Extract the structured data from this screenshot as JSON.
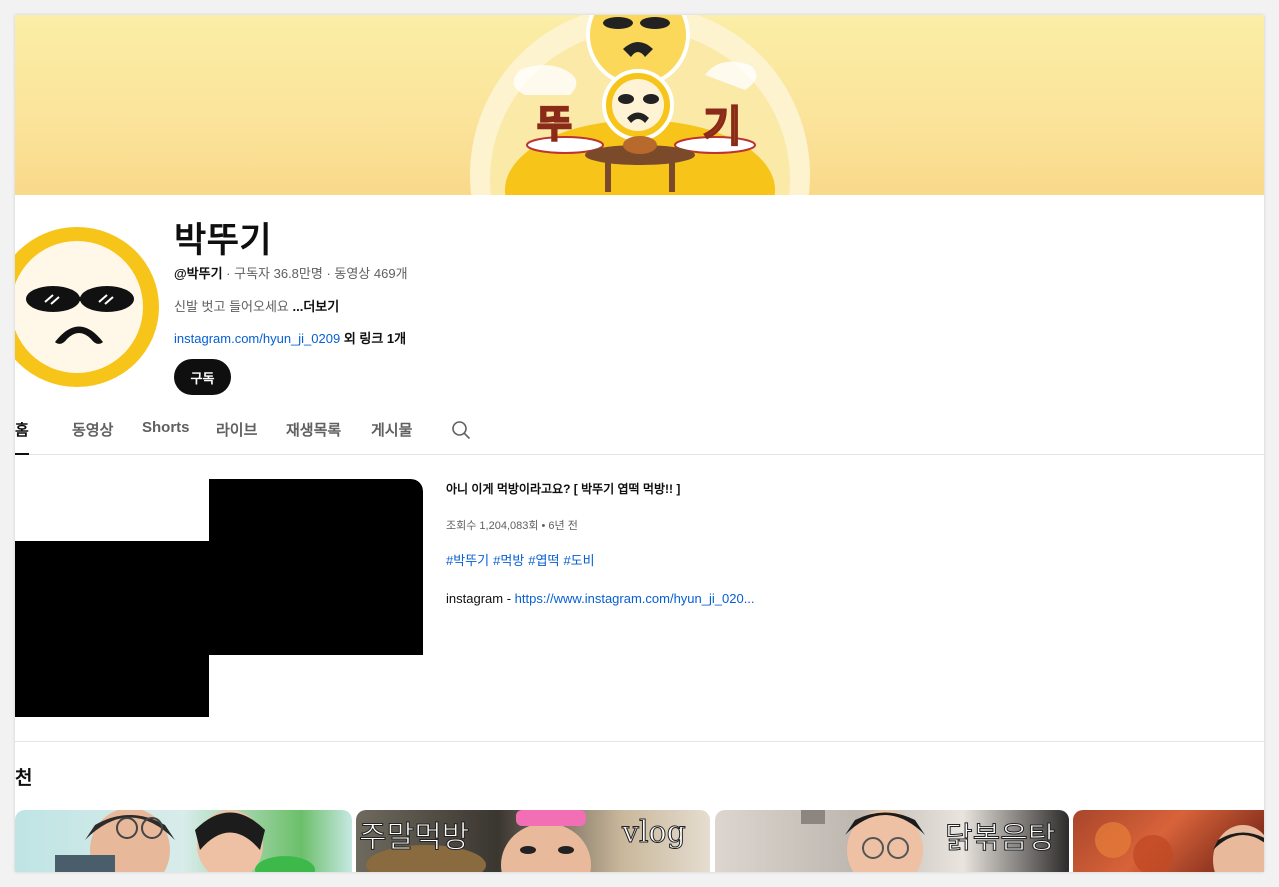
{
  "channel": {
    "name": "박뚜기",
    "handle": "@박뚜기",
    "meta_rest": " · 구독자 36.8만명 · 동영상 469개",
    "description": "신발 벗고 들어오세요 ",
    "more_label": "...더보기",
    "link_text": "instagram.com/hyun_ji_0209",
    "extra_links": " 외 링크 1개",
    "subscribe_label": "구독",
    "banner_text_left": "뚜",
    "banner_text_right": "기"
  },
  "tabs": [
    {
      "label": "홈",
      "active": true
    },
    {
      "label": "동영상"
    },
    {
      "label": "Shorts"
    },
    {
      "label": "라이브"
    },
    {
      "label": "재생목록"
    },
    {
      "label": "게시물"
    }
  ],
  "featured": {
    "title": "아니 이게 먹방이라고요? [ 박뚜기 엽떡 먹방!! ]",
    "views": "조회수 1,204,083회 • 6년 전",
    "tags": [
      "#박뚜기",
      "#먹방",
      "#엽떡",
      "#도비"
    ],
    "insta_prefix": "instagram - ",
    "insta_link": "https://www.instagram.com/hyun_ji_020..."
  },
  "section": {
    "title": "천"
  },
  "cards": [
    {
      "overlay": ""
    },
    {
      "overlay": "주말먹방",
      "overlay2": "vlog"
    },
    {
      "overlay": "닭볶음탕"
    },
    {
      "overlay": ""
    }
  ],
  "colors": {
    "banner": "#fbe39a",
    "accent_link": "#065fd4",
    "avatar_ring": "#f7c41a"
  }
}
